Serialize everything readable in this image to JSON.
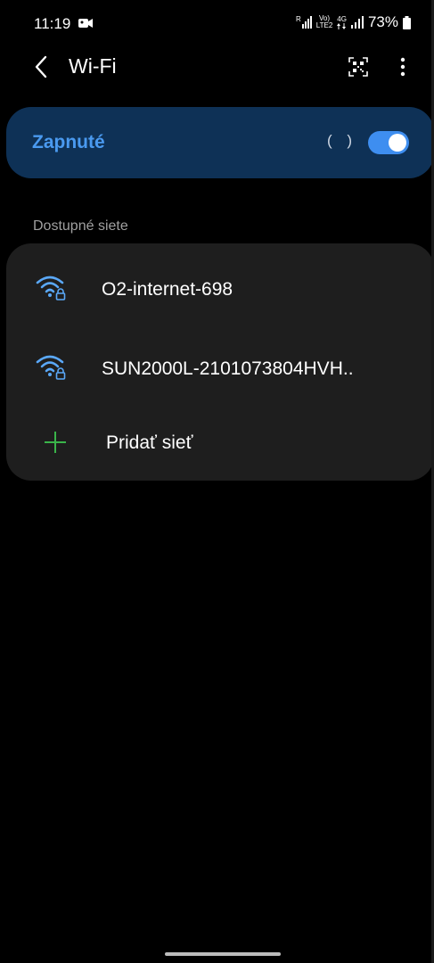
{
  "status_bar": {
    "time": "11:19",
    "sim1_tag": "R",
    "volte_tag": "Vo)",
    "lte_tag": "LTE2",
    "net_type": "4G",
    "battery_percent": "73%"
  },
  "header": {
    "title": "Wi-Fi",
    "icons": {
      "back": "chevron-left-icon",
      "qr": "qr-scanner-icon",
      "more": "more-vertical-icon"
    }
  },
  "wifi_toggle": {
    "label": "Zapnuté",
    "state": "on",
    "scanning_glyph": "( )",
    "color_label": "#4a9af0",
    "color_bg": "#0e3156",
    "color_switch": "#3e8ef0"
  },
  "available_networks": {
    "section_title": "Dostupné siete",
    "networks": [
      {
        "ssid": "O2-internet-698",
        "secured": true,
        "icon": "wifi-lock-icon"
      },
      {
        "ssid": "SUN2000L-2101073804HVH..",
        "secured": true,
        "icon": "wifi-lock-icon"
      }
    ],
    "add_network": {
      "label": "Pridať sieť",
      "icon": "plus-icon",
      "icon_color": "#3ab44a"
    }
  }
}
